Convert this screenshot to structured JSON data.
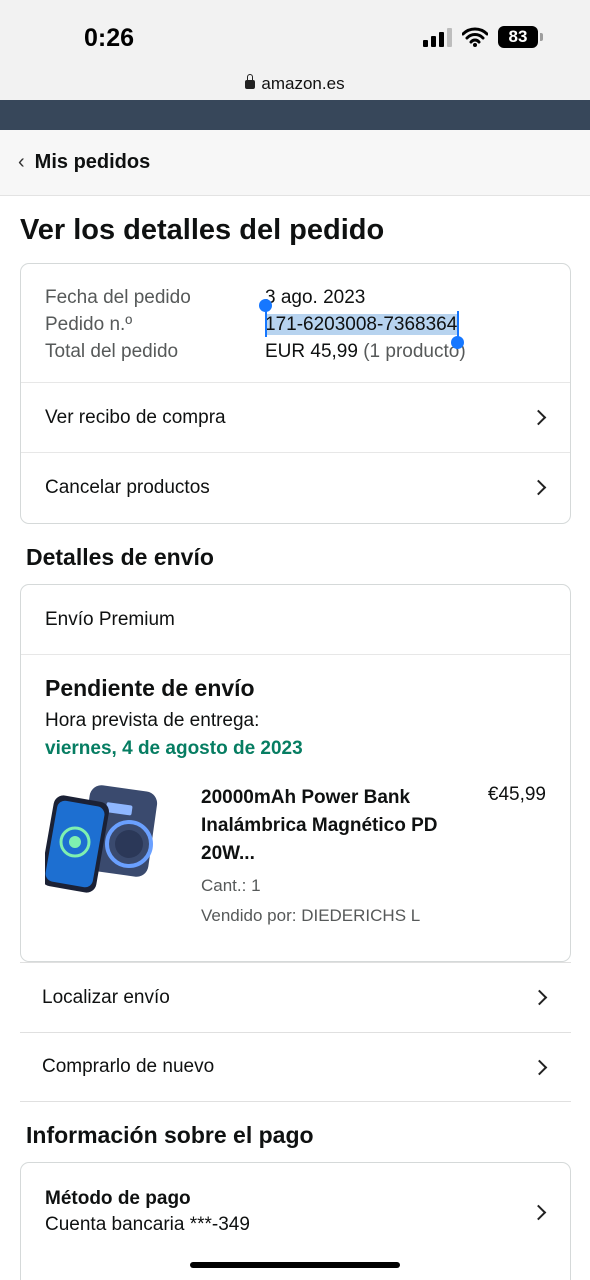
{
  "status": {
    "time": "0:26",
    "battery": "83",
    "url": "amazon.es"
  },
  "nav": {
    "back_label": "Mis pedidos"
  },
  "page": {
    "title": "Ver los detalles del pedido"
  },
  "summary": {
    "date_label": "Fecha del pedido",
    "date_value": "3 ago. 2023",
    "order_label": "Pedido n.º",
    "order_value": "171-6203008-7368364",
    "total_label": "Total del pedido",
    "total_value": "EUR 45,99",
    "total_note": "(1 producto)"
  },
  "actions": {
    "receipt": "Ver recibo de compra",
    "cancel": "Cancelar productos"
  },
  "shipping": {
    "section_title": "Detalles de envío",
    "type": "Envío Premium",
    "status": "Pendiente de envío",
    "eta_label": "Hora prevista de entrega:",
    "eta_date": "viernes, 4 de agosto de 2023",
    "product": {
      "name": "20000mAh Power Bank Inalámbrica Magnético PD 20W...",
      "qty": "Cant.: 1",
      "seller": "Vendido por: DIEDERICHS L",
      "price": "€45,99"
    }
  },
  "links": {
    "track": "Localizar envío",
    "buy_again": "Comprarlo de nuevo"
  },
  "payment": {
    "section_title": "Información sobre el pago",
    "method_label": "Método de pago",
    "method_value": "Cuenta bancaria ***-349"
  },
  "colors": {
    "nav_strip": "#37475a",
    "delivery_green": "#067d62",
    "selection": "#b7d3ef",
    "handle": "#1677ff"
  }
}
